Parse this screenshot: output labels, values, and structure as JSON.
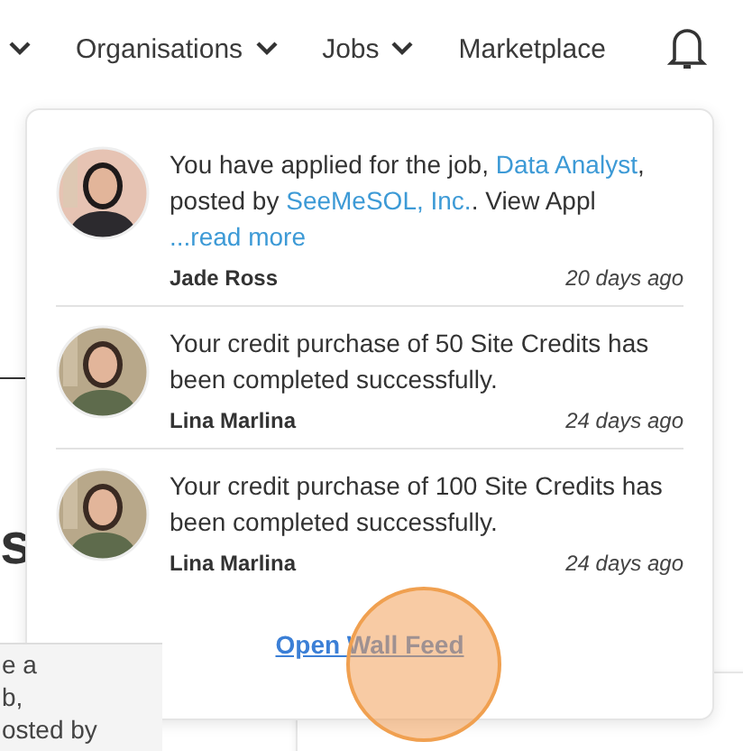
{
  "nav": {
    "items": [
      {
        "label": "Organisations",
        "has_menu": true
      },
      {
        "label": "Jobs",
        "has_menu": true
      },
      {
        "label": "Marketplace",
        "has_menu": false
      }
    ]
  },
  "background": {
    "heading": "s",
    "snippets": [
      "e a",
      "b,",
      "osted by"
    ]
  },
  "notifications": {
    "items": [
      {
        "message": [
          {
            "text": "You have applied for the job, ",
            "link": false
          },
          {
            "text": "Data Analyst",
            "link": true
          },
          {
            "text": ", posted by ",
            "link": false
          },
          {
            "text": "SeeMeSOL, Inc.",
            "link": true
          },
          {
            "text": ". View Appl",
            "link": false
          }
        ],
        "read_more": "...read more",
        "author": "Jade Ross",
        "time": "20 days ago"
      },
      {
        "message": [
          {
            "text": "Your credit purchase of 50 Site Credits has been completed successfully.",
            "link": false
          }
        ],
        "author": "Lina Marlina",
        "time": "24 days ago"
      },
      {
        "message": [
          {
            "text": "Your credit purchase of 100 Site Credits has been completed successfully.",
            "link": false
          }
        ],
        "author": "Lina Marlina",
        "time": "24 days ago"
      }
    ],
    "footer_link": "Open Wall Feed"
  }
}
